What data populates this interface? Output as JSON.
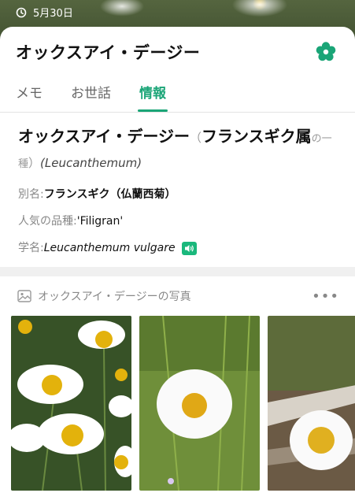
{
  "top_bar": {
    "date": "5月30日"
  },
  "header": {
    "title": "オックスアイ・デージー"
  },
  "tabs": [
    {
      "label": "メモ"
    },
    {
      "label": "お世話"
    },
    {
      "label": "情報"
    }
  ],
  "info": {
    "name": "オックスアイ・デージー",
    "genus_name": "フランスギク属",
    "rank_suffix": "の一種",
    "genus_latin": "(Leucanthemum)",
    "alias_label": "別名: ",
    "alias_value": "フランスギク（仏蘭西菊）",
    "cultivar_label": "人気の品種: ",
    "cultivar_value": "'Filigran'",
    "scientific_label": "学名: ",
    "scientific_value": "Leucanthemum vulgare"
  },
  "photos_section": {
    "title": "オックスアイ・デージーの写真",
    "more": "•••"
  },
  "colors": {
    "accent": "#1aa577",
    "speaker": "#1ab87c"
  },
  "icons": [
    "clock-icon",
    "flower-settings-icon",
    "speaker-icon",
    "photo-gallery-icon",
    "more-icon"
  ]
}
